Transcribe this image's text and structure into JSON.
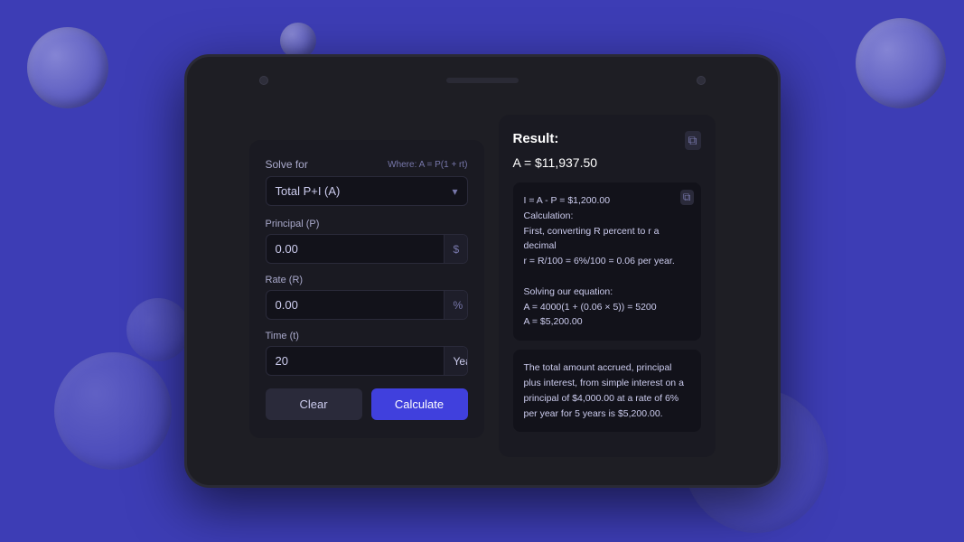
{
  "background": {
    "color": "#3d3db5"
  },
  "calculator": {
    "solve_for_label": "Solve for",
    "formula_hint": "Where: A = P(1 + rt)",
    "selected_option": "Total P+I (A)",
    "principal_label": "Principal (P)",
    "principal_value": "0.00",
    "principal_suffix": "$",
    "rate_label": "Rate (R)",
    "rate_value": "0.00",
    "rate_suffix": "%",
    "time_label": "Time (t)",
    "time_value": "20",
    "time_unit": "Years",
    "clear_button": "Clear",
    "calculate_button": "Calculate"
  },
  "result": {
    "title": "Result:",
    "main_value": "A = $11,937.50",
    "detail_line1": "I = A - P = $1,200.00",
    "detail_line2": "Calculation:",
    "detail_line3": "First, converting R percent to r a decimal",
    "detail_line4": "r = R/100 = 6%/100 = 0.06 per year.",
    "detail_line5": "",
    "detail_line6": "Solving our equation:",
    "detail_line7": "A = 4000(1 + (0.06 × 5)) = 5200",
    "detail_line8": "A = $5,200.00",
    "detail_summary": "The total amount accrued, principal plus interest, from simple interest on a principal of $4,000.00 at a rate of 6% per year for 5 years is $5,200.00.",
    "copy_icon": "⧉",
    "chevron_down": "▾"
  }
}
